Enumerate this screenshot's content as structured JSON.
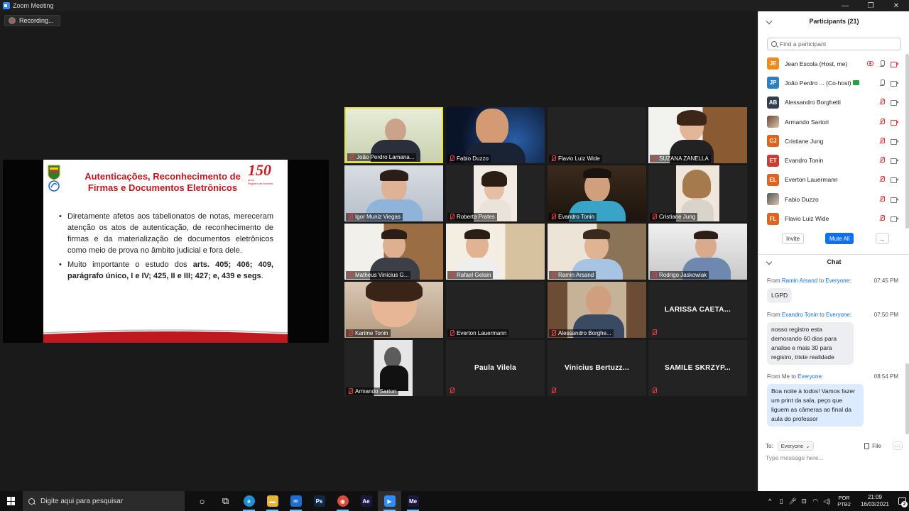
{
  "window": {
    "title": "Zoom Meeting",
    "controls": [
      "—",
      "❐",
      "✕"
    ]
  },
  "recording": {
    "label": "Recording..."
  },
  "slide": {
    "title_line1": "Autenticações, Reconhecimento de",
    "title_line2": "Firmas e Documentos Eletrônicos",
    "logo_number": "150",
    "logo_sub1": "anos",
    "logo_sub2": "Registro de Imóveis",
    "bullet1": "Diretamente afetos aos tabelionatos de notas, mereceram atenção os atos de autenticação, de reconhecimento de firmas e da materialização de documentos eletrônicos como meio de prova no âmbito judicial e fora dele.",
    "bullet2_pre": "Muito importante o estudo dos ",
    "bullet2_bold": "arts. 405; 406; 409, parágrafo único, I e IV; 425, II e III; 427; e, 439 e segs",
    "bullet2_post": "."
  },
  "grid": {
    "tiles": [
      {
        "name": "João Perdro Lamana...",
        "video": true
      },
      {
        "name": "Fabio Duzzo",
        "video": true
      },
      {
        "name": "Flavio Luiz Wide",
        "video": true
      },
      {
        "name": "SUZANA ZANELLA",
        "video": true
      },
      {
        "name": "Igor Muniz Viegas",
        "video": true
      },
      {
        "name": "Roberta Prates",
        "video": true
      },
      {
        "name": "Evandro Tonin",
        "video": true
      },
      {
        "name": "Cristiane Jung",
        "video": true
      },
      {
        "name": "Matheus Vinicius G...",
        "video": true
      },
      {
        "name": "Rafael Gelain",
        "video": true
      },
      {
        "name": "Ramin Arsand",
        "video": true
      },
      {
        "name": "Rodrigo Jaskowiak",
        "video": true
      },
      {
        "name": "Karime Tonin",
        "video": true
      },
      {
        "name": "Everton Lauermann",
        "video": true
      },
      {
        "name": "Alessandro Borghe...",
        "video": true
      },
      {
        "name": "",
        "video": false,
        "display": "LARISSA  CAETA..."
      },
      {
        "name": "Armando Sartori",
        "video": true
      },
      {
        "name": "",
        "video": false,
        "display": "Paula Vilela"
      },
      {
        "name": "",
        "video": false,
        "display": "Vinicius  Bertuzz..."
      },
      {
        "name": "",
        "video": false,
        "display": "SAMILE SKRZYP..."
      }
    ]
  },
  "participants": {
    "header": "Participants (21)",
    "search_placeholder": "Find a participant",
    "list": [
      {
        "initials": "JE",
        "color": "#f08c1e",
        "name": "Jean Escola (Host, me)",
        "mic": "on",
        "cam": "off",
        "rec": true
      },
      {
        "initials": "JP",
        "color": "#2d7fc4",
        "name": "João Perdro ... (Co-host)",
        "mic": "on",
        "cam": "on",
        "rec": false,
        "cohost": true
      },
      {
        "initials": "AB",
        "color": "#333f4f",
        "name": "Alessandro Borghetti",
        "mic": "muted",
        "cam": "on",
        "rec": false
      },
      {
        "initials": "",
        "color": "#6b4a36",
        "name": "Armando Sartori",
        "mic": "muted",
        "cam": "off",
        "rec": false
      },
      {
        "initials": "CJ",
        "color": "#e0641e",
        "name": "Cristiane Jung",
        "mic": "muted",
        "cam": "on",
        "rec": false
      },
      {
        "initials": "ET",
        "color": "#cf3b32",
        "name": "Evandro Tonin",
        "mic": "muted",
        "cam": "on",
        "rec": false
      },
      {
        "initials": "EL",
        "color": "#e0641e",
        "name": "Everton Lauermann",
        "mic": "muted",
        "cam": "on",
        "rec": false
      },
      {
        "initials": "",
        "color": "#555555",
        "name": "Fabio Duzzo",
        "mic": "muted",
        "cam": "on",
        "rec": false
      },
      {
        "initials": "FL",
        "color": "#e0641e",
        "name": "Flavio Luiz Wide",
        "mic": "muted",
        "cam": "on",
        "rec": false
      }
    ],
    "buttons": {
      "invite": "Invite",
      "mute_all": "Mute All",
      "more": "..."
    }
  },
  "chat": {
    "header": "Chat",
    "messages": [
      {
        "from_prefix": "From ",
        "from": "Ramin Arsand",
        "to_prefix": " to ",
        "to": "Everyone",
        "to_suffix": ":",
        "time": "07:45 PM",
        "text": "LGPD"
      },
      {
        "from_prefix": "From ",
        "from": "Evandro Tonin",
        "to_prefix": " to ",
        "to": "Everyone",
        "to_suffix": ":",
        "time": "07:50 PM",
        "text": "nosso registro esta demorando 60 dias para analise e mais 30 para registro, triste realidade"
      },
      {
        "from_prefix": "From Me to ",
        "from": "",
        "to_prefix": "",
        "to": "Everyone",
        "to_suffix": ":",
        "time": "08:54 PM",
        "text": "Boa noite à todos! Vamos fazer um print da sala, peço que liguem as câmeras ao final da aula do professor"
      }
    ],
    "to_label": "To:",
    "to_value": "Everyone",
    "file_label": "File",
    "more_label": "···",
    "input_placeholder": "Type message here..."
  },
  "taskbar": {
    "search_placeholder": "Digite aqui para pesquisar",
    "apps": [
      {
        "name": "cortana-icon",
        "glyph": "○",
        "color": "transparent"
      },
      {
        "name": "task-view-icon",
        "glyph": "⧉",
        "color": "transparent"
      },
      {
        "name": "edge-icon",
        "glyph": "e",
        "color": "#1f8fd6"
      },
      {
        "name": "file-explorer-icon",
        "glyph": "▬",
        "color": "#e8b43a"
      },
      {
        "name": "mail-icon",
        "glyph": "✉",
        "color": "#1d6ed1"
      },
      {
        "name": "photoshop-icon",
        "glyph": "Ps",
        "color": "#0b2a4a"
      },
      {
        "name": "chrome-icon",
        "glyph": "◉",
        "color": "#d84b3c"
      },
      {
        "name": "after-effects-icon",
        "glyph": "Ae",
        "color": "#1a1740"
      },
      {
        "name": "zoom-icon",
        "glyph": "▶",
        "color": "#2d8cff"
      },
      {
        "name": "media-encoder-icon",
        "glyph": "Me",
        "color": "#1a1740"
      }
    ],
    "lang_top": "POR",
    "lang_bottom": "PTB2",
    "time": "21:09",
    "date": "16/03/2021",
    "notif_count": "2"
  }
}
